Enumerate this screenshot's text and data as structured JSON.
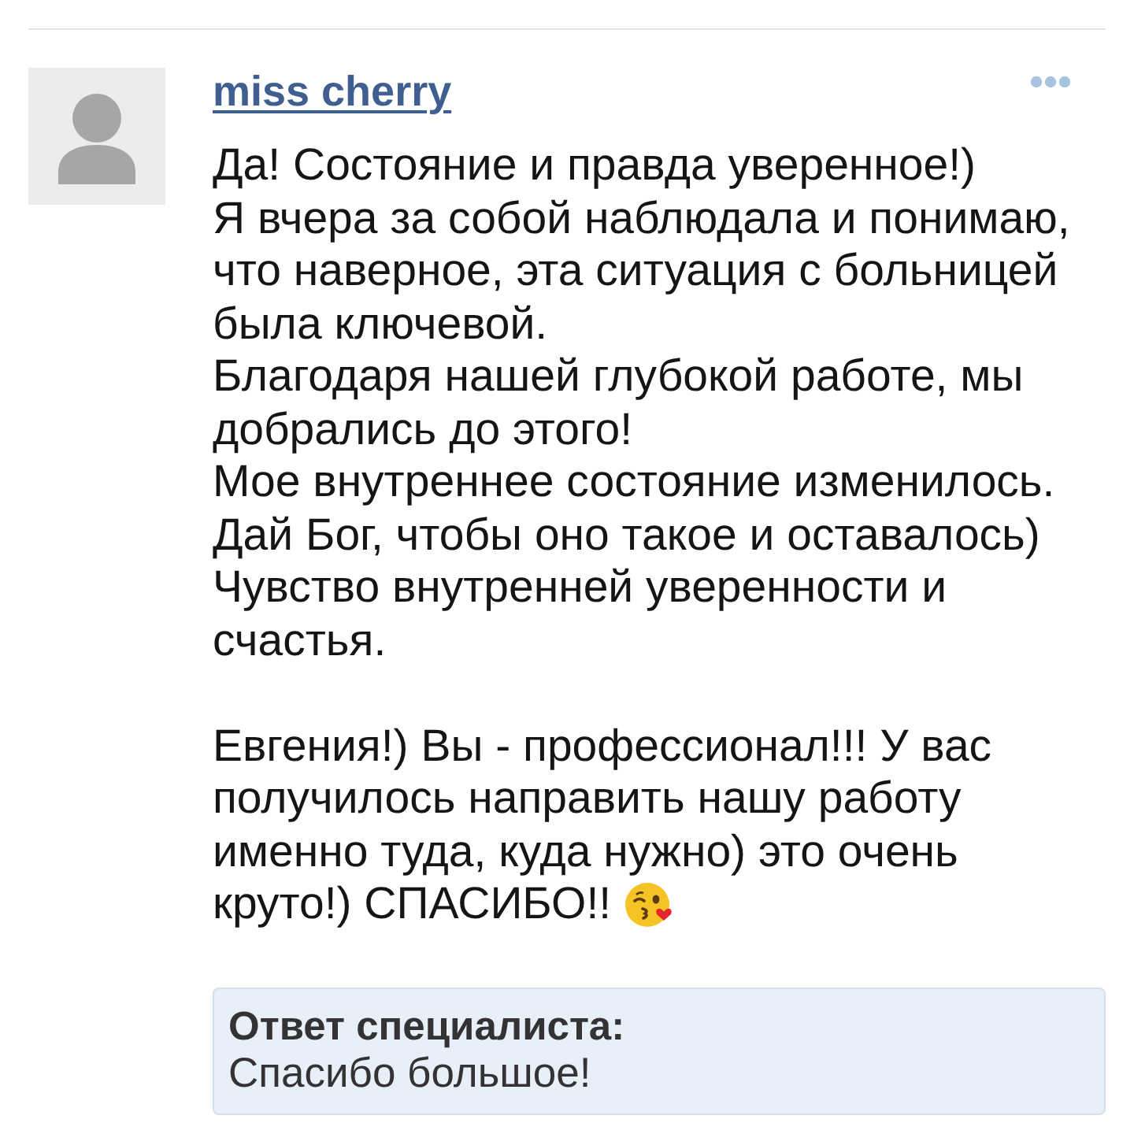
{
  "comment": {
    "author": "miss cherry",
    "paragraphs": [
      [
        "Да! Состояние и правда уверенное!)",
        "Я вчера за собой наблюдала и понимаю,",
        "что наверное, эта ситуация с больницей",
        "была ключевой.",
        "Благодаря нашей глубокой работе, мы",
        "добрались до этого!",
        "Мое внутреннее состояние изменилось.",
        "Дай Бог, чтобы оно такое и оставалось)",
        "Чувство внутренней уверенности и",
        "счастья."
      ],
      [
        "Евгения!) Вы - профессионал!!! У вас",
        "получилось направить нашу работу",
        "именно туда, куда нужно) это очень",
        "круто!) СПАСИБО!!"
      ]
    ],
    "reply": {
      "title": "Ответ специалиста:",
      "text": "Спасибо большое!"
    }
  }
}
